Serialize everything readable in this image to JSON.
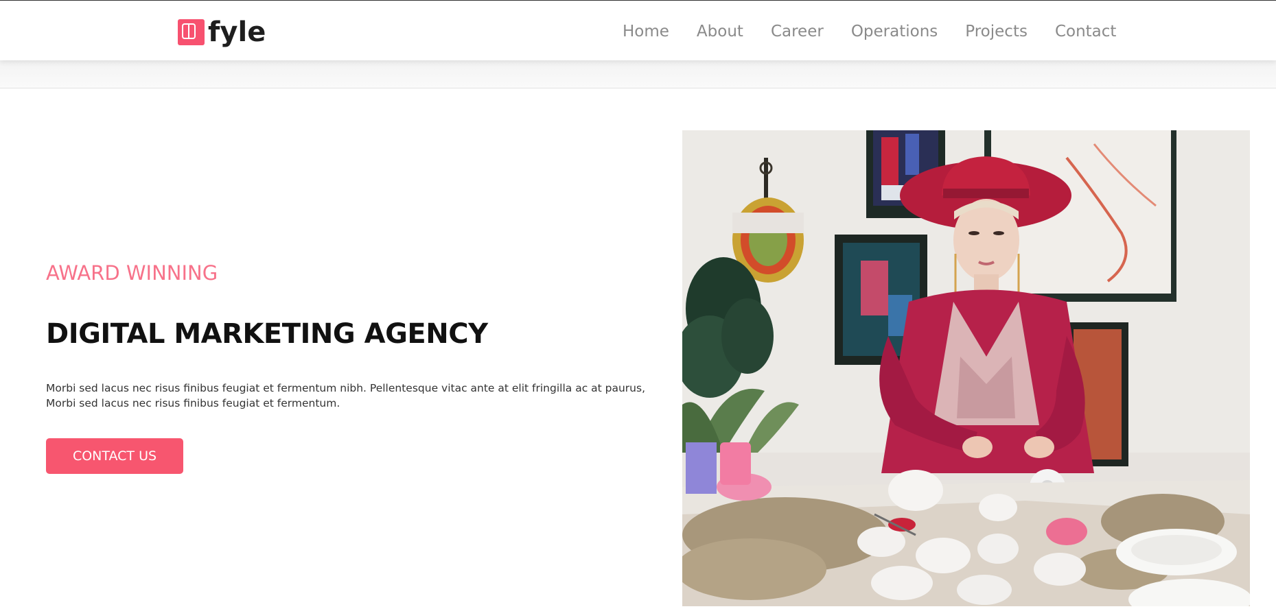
{
  "brand": {
    "name": "fyle",
    "color": "#f7516f"
  },
  "nav": {
    "items": [
      {
        "label": "Home"
      },
      {
        "label": "About"
      },
      {
        "label": "Career"
      },
      {
        "label": "Operations"
      },
      {
        "label": "Projects"
      },
      {
        "label": "Contact"
      }
    ]
  },
  "hero": {
    "kicker": "AWARD WINNING",
    "title": "DIGITAL MARKETING AGENCY",
    "description": "Morbi sed lacus nec risus finibus feugiat et fermentum nibh. Pellentesque vitac ante at elit fringilla ac at paurus, Morbi sed lacus nec risus finibus feugiat et fermentum.",
    "cta_label": "CONTACT US",
    "accent_color": "#f7566f",
    "kicker_color": "#f7728a"
  },
  "image": {
    "icon": "hero-photo"
  }
}
